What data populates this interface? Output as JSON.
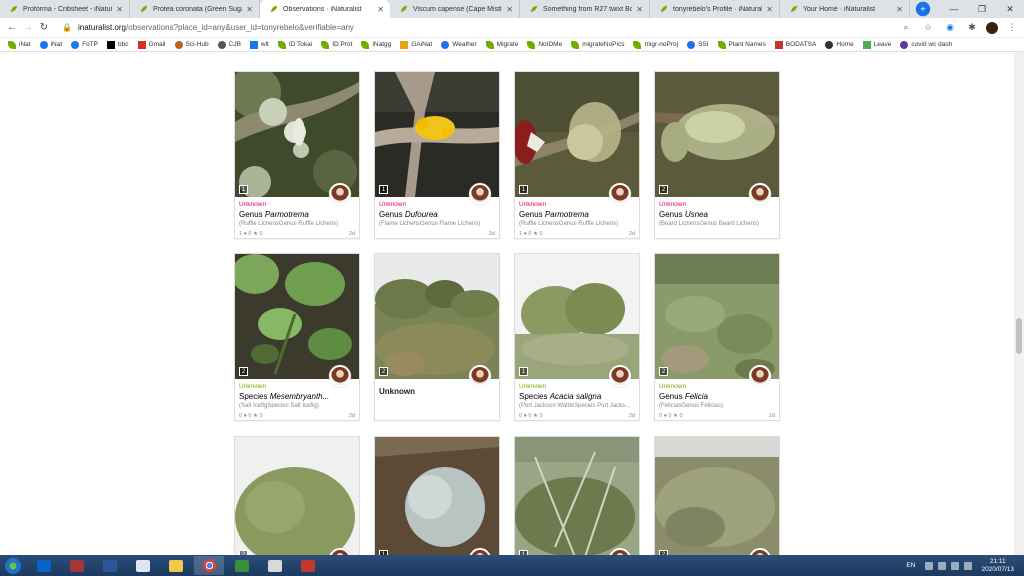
{
  "browser": {
    "tabs": [
      {
        "label": "Proforma - Cribsheet - iNaturalist",
        "active": false
      },
      {
        "label": "Protea coronata (Green Sugarbu",
        "active": false
      },
      {
        "label": "Observations · iNaturalist",
        "active": true
      },
      {
        "label": "Viscum capense (Cape Mistletoe",
        "active": false
      },
      {
        "label": "Something from R27 twixt Bottl",
        "active": false
      },
      {
        "label": "tonyrebelo's Profile · iNaturalist",
        "active": false
      },
      {
        "label": "Your Home · iNaturalist",
        "active": false
      }
    ],
    "url_host": "inaturalist.org",
    "url_path": "/observations?place_id=any&user_id=tonyrebelo&verifiable=any",
    "bookmarks": [
      "iNat",
      "iNat",
      "FoTP",
      "bbc",
      "Gmail",
      "Sci-Hub",
      "CJB",
      "wlt",
      "ID Tokai",
      "ID.Prot",
      "iNatgg",
      "GAiNat",
      "Weather",
      "Migrate",
      "NoIDMe",
      "migrateNoPics",
      "migr-noProj",
      "SSI",
      "Plant Names",
      "BODATSA",
      "Home",
      "Leave",
      "covid wc dash"
    ]
  },
  "cards": [
    {
      "badge": "1",
      "status": "Unknown",
      "rank": "Genus",
      "name": "Parmotrema",
      "common": "(Ruffle LichensGenus Ruffle Lichens)",
      "stats": "1 ● 0 ★ 0",
      "age": "2d"
    },
    {
      "badge": "1",
      "status": "Unknown",
      "rank": "Genus",
      "name": "Dufourea",
      "common": "(Flame LichensGenus Flame Lichens)",
      "stats": "",
      "age": "2d"
    },
    {
      "badge": "1",
      "status": "Unknown",
      "rank": "Genus",
      "name": "Parmotrema",
      "common": "(Ruffle LichensGenus Ruffle Lichens)",
      "stats": "1 ● 0 ★ 0",
      "age": "2d"
    },
    {
      "badge": "2",
      "status": "Unknown",
      "rank": "Genus",
      "name": "Usnea",
      "common": "(Beard LichensGenus Beard Lichens)",
      "stats": "",
      "age": ""
    },
    {
      "badge": "2",
      "status": "Unknown",
      "rank": "Species",
      "name": "Mesembryanth...",
      "common": "(Salt IcefigSpecies Salt Icefig)",
      "stats": "0 ● 0 ★ 0",
      "age": "2d"
    },
    {
      "badge": "2",
      "status": "",
      "rank": "",
      "name": "",
      "common": "",
      "stats": "",
      "age": "",
      "unknown_title": "Unknown"
    },
    {
      "badge": "1",
      "status": "Unknown",
      "rank": "Species",
      "name": "Acacia saligna",
      "common": "(Port Jackson WattleSpecies Port Jacks...",
      "stats": "0 ● 0 ★ 0",
      "age": "2d"
    },
    {
      "badge": "2",
      "status": "Unknown",
      "rank": "Genus",
      "name": "Felicia",
      "common": "(FeliciasGenus Felicias)",
      "stats": "0 ● 0 ★ 0",
      "age": "2d"
    },
    {
      "badge": "2",
      "status": "",
      "rank": "",
      "name": "",
      "common": "",
      "stats": "",
      "age": ""
    },
    {
      "badge": "1",
      "status": "",
      "rank": "",
      "name": "",
      "common": "",
      "stats": "",
      "age": ""
    },
    {
      "badge": "1",
      "status": "",
      "rank": "",
      "name": "",
      "common": "",
      "stats": "",
      "age": ""
    },
    {
      "badge": "2",
      "status": "",
      "rank": "",
      "name": "",
      "common": "",
      "stats": "",
      "age": ""
    }
  ],
  "taskbar": {
    "lang": "EN",
    "time": "21:11",
    "date": "2020/07/13"
  },
  "colors": {
    "unknown_pink": "#e6005c",
    "unknown_green": "#74ac00",
    "inat_green": "#74ac00",
    "taskbar": "#1d3a5f",
    "tab_strip": "#dee1e6"
  }
}
